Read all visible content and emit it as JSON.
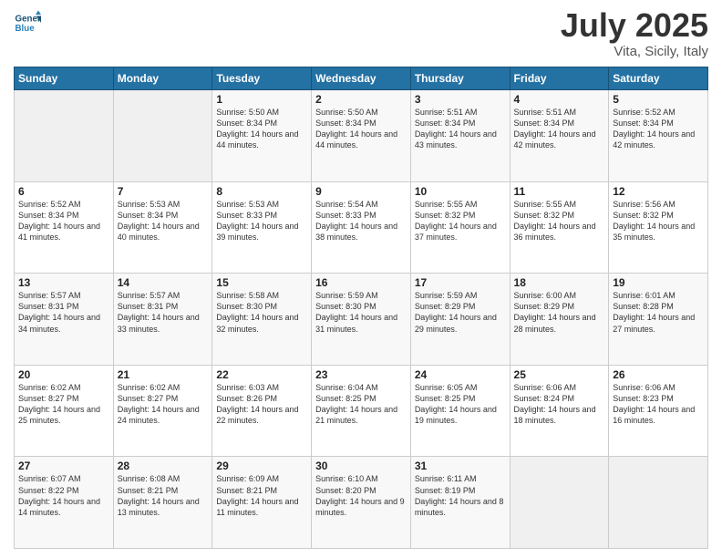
{
  "header": {
    "logo_line1": "General",
    "logo_line2": "Blue",
    "month": "July 2025",
    "location": "Vita, Sicily, Italy"
  },
  "weekdays": [
    "Sunday",
    "Monday",
    "Tuesday",
    "Wednesday",
    "Thursday",
    "Friday",
    "Saturday"
  ],
  "weeks": [
    [
      {
        "day": "",
        "sunrise": "",
        "sunset": "",
        "daylight": ""
      },
      {
        "day": "",
        "sunrise": "",
        "sunset": "",
        "daylight": ""
      },
      {
        "day": "1",
        "sunrise": "Sunrise: 5:50 AM",
        "sunset": "Sunset: 8:34 PM",
        "daylight": "Daylight: 14 hours and 44 minutes."
      },
      {
        "day": "2",
        "sunrise": "Sunrise: 5:50 AM",
        "sunset": "Sunset: 8:34 PM",
        "daylight": "Daylight: 14 hours and 44 minutes."
      },
      {
        "day": "3",
        "sunrise": "Sunrise: 5:51 AM",
        "sunset": "Sunset: 8:34 PM",
        "daylight": "Daylight: 14 hours and 43 minutes."
      },
      {
        "day": "4",
        "sunrise": "Sunrise: 5:51 AM",
        "sunset": "Sunset: 8:34 PM",
        "daylight": "Daylight: 14 hours and 42 minutes."
      },
      {
        "day": "5",
        "sunrise": "Sunrise: 5:52 AM",
        "sunset": "Sunset: 8:34 PM",
        "daylight": "Daylight: 14 hours and 42 minutes."
      }
    ],
    [
      {
        "day": "6",
        "sunrise": "Sunrise: 5:52 AM",
        "sunset": "Sunset: 8:34 PM",
        "daylight": "Daylight: 14 hours and 41 minutes."
      },
      {
        "day": "7",
        "sunrise": "Sunrise: 5:53 AM",
        "sunset": "Sunset: 8:34 PM",
        "daylight": "Daylight: 14 hours and 40 minutes."
      },
      {
        "day": "8",
        "sunrise": "Sunrise: 5:53 AM",
        "sunset": "Sunset: 8:33 PM",
        "daylight": "Daylight: 14 hours and 39 minutes."
      },
      {
        "day": "9",
        "sunrise": "Sunrise: 5:54 AM",
        "sunset": "Sunset: 8:33 PM",
        "daylight": "Daylight: 14 hours and 38 minutes."
      },
      {
        "day": "10",
        "sunrise": "Sunrise: 5:55 AM",
        "sunset": "Sunset: 8:32 PM",
        "daylight": "Daylight: 14 hours and 37 minutes."
      },
      {
        "day": "11",
        "sunrise": "Sunrise: 5:55 AM",
        "sunset": "Sunset: 8:32 PM",
        "daylight": "Daylight: 14 hours and 36 minutes."
      },
      {
        "day": "12",
        "sunrise": "Sunrise: 5:56 AM",
        "sunset": "Sunset: 8:32 PM",
        "daylight": "Daylight: 14 hours and 35 minutes."
      }
    ],
    [
      {
        "day": "13",
        "sunrise": "Sunrise: 5:57 AM",
        "sunset": "Sunset: 8:31 PM",
        "daylight": "Daylight: 14 hours and 34 minutes."
      },
      {
        "day": "14",
        "sunrise": "Sunrise: 5:57 AM",
        "sunset": "Sunset: 8:31 PM",
        "daylight": "Daylight: 14 hours and 33 minutes."
      },
      {
        "day": "15",
        "sunrise": "Sunrise: 5:58 AM",
        "sunset": "Sunset: 8:30 PM",
        "daylight": "Daylight: 14 hours and 32 minutes."
      },
      {
        "day": "16",
        "sunrise": "Sunrise: 5:59 AM",
        "sunset": "Sunset: 8:30 PM",
        "daylight": "Daylight: 14 hours and 31 minutes."
      },
      {
        "day": "17",
        "sunrise": "Sunrise: 5:59 AM",
        "sunset": "Sunset: 8:29 PM",
        "daylight": "Daylight: 14 hours and 29 minutes."
      },
      {
        "day": "18",
        "sunrise": "Sunrise: 6:00 AM",
        "sunset": "Sunset: 8:29 PM",
        "daylight": "Daylight: 14 hours and 28 minutes."
      },
      {
        "day": "19",
        "sunrise": "Sunrise: 6:01 AM",
        "sunset": "Sunset: 8:28 PM",
        "daylight": "Daylight: 14 hours and 27 minutes."
      }
    ],
    [
      {
        "day": "20",
        "sunrise": "Sunrise: 6:02 AM",
        "sunset": "Sunset: 8:27 PM",
        "daylight": "Daylight: 14 hours and 25 minutes."
      },
      {
        "day": "21",
        "sunrise": "Sunrise: 6:02 AM",
        "sunset": "Sunset: 8:27 PM",
        "daylight": "Daylight: 14 hours and 24 minutes."
      },
      {
        "day": "22",
        "sunrise": "Sunrise: 6:03 AM",
        "sunset": "Sunset: 8:26 PM",
        "daylight": "Daylight: 14 hours and 22 minutes."
      },
      {
        "day": "23",
        "sunrise": "Sunrise: 6:04 AM",
        "sunset": "Sunset: 8:25 PM",
        "daylight": "Daylight: 14 hours and 21 minutes."
      },
      {
        "day": "24",
        "sunrise": "Sunrise: 6:05 AM",
        "sunset": "Sunset: 8:25 PM",
        "daylight": "Daylight: 14 hours and 19 minutes."
      },
      {
        "day": "25",
        "sunrise": "Sunrise: 6:06 AM",
        "sunset": "Sunset: 8:24 PM",
        "daylight": "Daylight: 14 hours and 18 minutes."
      },
      {
        "day": "26",
        "sunrise": "Sunrise: 6:06 AM",
        "sunset": "Sunset: 8:23 PM",
        "daylight": "Daylight: 14 hours and 16 minutes."
      }
    ],
    [
      {
        "day": "27",
        "sunrise": "Sunrise: 6:07 AM",
        "sunset": "Sunset: 8:22 PM",
        "daylight": "Daylight: 14 hours and 14 minutes."
      },
      {
        "day": "28",
        "sunrise": "Sunrise: 6:08 AM",
        "sunset": "Sunset: 8:21 PM",
        "daylight": "Daylight: 14 hours and 13 minutes."
      },
      {
        "day": "29",
        "sunrise": "Sunrise: 6:09 AM",
        "sunset": "Sunset: 8:21 PM",
        "daylight": "Daylight: 14 hours and 11 minutes."
      },
      {
        "day": "30",
        "sunrise": "Sunrise: 6:10 AM",
        "sunset": "Sunset: 8:20 PM",
        "daylight": "Daylight: 14 hours and 9 minutes."
      },
      {
        "day": "31",
        "sunrise": "Sunrise: 6:11 AM",
        "sunset": "Sunset: 8:19 PM",
        "daylight": "Daylight: 14 hours and 8 minutes."
      },
      {
        "day": "",
        "sunrise": "",
        "sunset": "",
        "daylight": ""
      },
      {
        "day": "",
        "sunrise": "",
        "sunset": "",
        "daylight": ""
      }
    ]
  ]
}
